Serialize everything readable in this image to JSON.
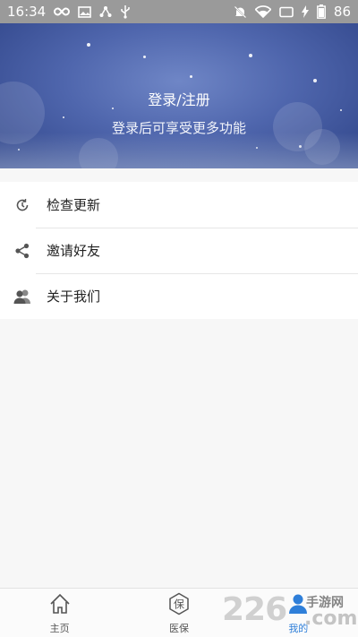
{
  "status_bar": {
    "time": "16:34",
    "battery": "86",
    "icons_left": [
      "infinity-icon",
      "image-icon",
      "share-icon",
      "usb-icon"
    ],
    "icons_right": [
      "mute-icon",
      "wifi-icon",
      "sim-icon",
      "charging-icon",
      "battery-icon"
    ]
  },
  "header": {
    "login_label": "登录/注册",
    "subtitle": "登录后可享受更多功能",
    "colors": {
      "banner_top": "#4f66ad",
      "banner_dark": "#2f4488"
    }
  },
  "menu": {
    "items": [
      {
        "label": "检查更新",
        "icon": "clock-icon"
      },
      {
        "label": "邀请好友",
        "icon": "share-icon"
      },
      {
        "label": "关于我们",
        "icon": "users-icon"
      }
    ]
  },
  "tabbar": {
    "tabs": [
      {
        "label": "主页",
        "icon": "home-icon",
        "active": false
      },
      {
        "label": "医保",
        "icon": "insurance-icon",
        "active": false
      },
      {
        "label": "我的",
        "icon": "profile-icon",
        "active": true
      }
    ],
    "active_color": "#2f7fd9"
  },
  "watermark": {
    "number": "226",
    "site": "手游网",
    "domain": ".com"
  }
}
